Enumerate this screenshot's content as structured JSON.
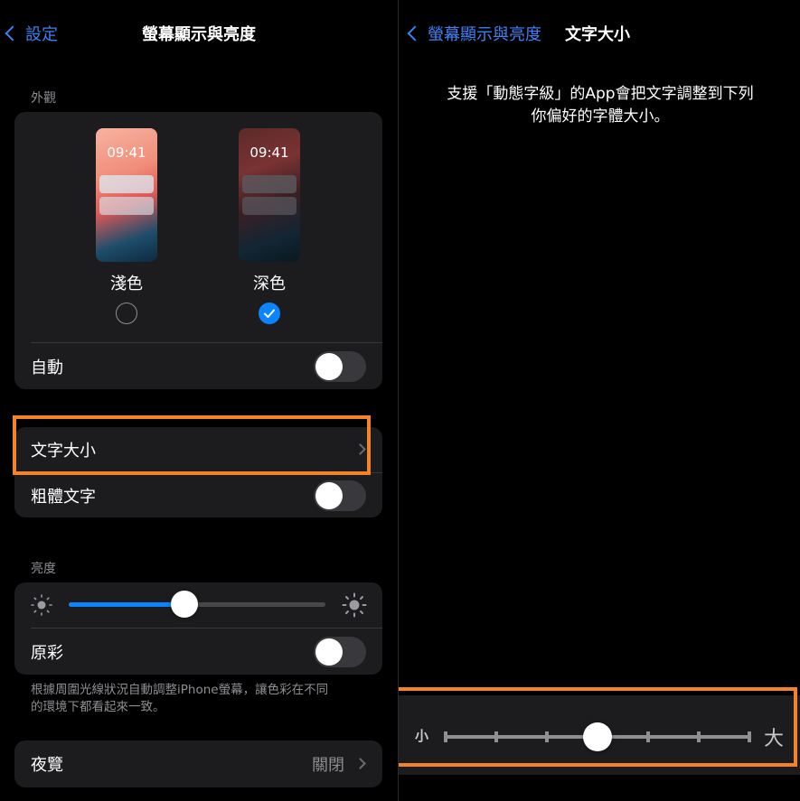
{
  "left": {
    "nav": {
      "back_label": "設定",
      "title": "螢幕顯示與亮度"
    },
    "appearance": {
      "section_label": "外觀",
      "light": {
        "preview_time": "09:41",
        "label": "淺色",
        "selected": false
      },
      "dark": {
        "preview_time": "09:41",
        "label": "深色",
        "selected": true
      },
      "auto_label": "自動",
      "auto_on": false
    },
    "text": {
      "text_size_label": "文字大小",
      "bold_text_label": "粗體文字",
      "bold_on": false
    },
    "brightness": {
      "section_label": "亮度",
      "level": 0.45,
      "true_tone_label": "原彩",
      "true_tone_on": false,
      "footnote": "根據周圍光線狀況自動調整iPhone螢幕，讓色彩在不同的環境下都看起來一致。"
    },
    "night_shift": {
      "label": "夜覽",
      "value": "關閉"
    }
  },
  "right": {
    "nav": {
      "back_label": "螢幕顯示與亮度",
      "title": "文字大小"
    },
    "description": "支援「動態字級」的App會把文字調整到下列你偏好的字體大小。",
    "slider": {
      "small_label": "小",
      "large_label": "大",
      "stops": 7,
      "selected_index": 3
    }
  },
  "colors": {
    "accent": "#0a84ff",
    "highlight": "#f4822a"
  }
}
